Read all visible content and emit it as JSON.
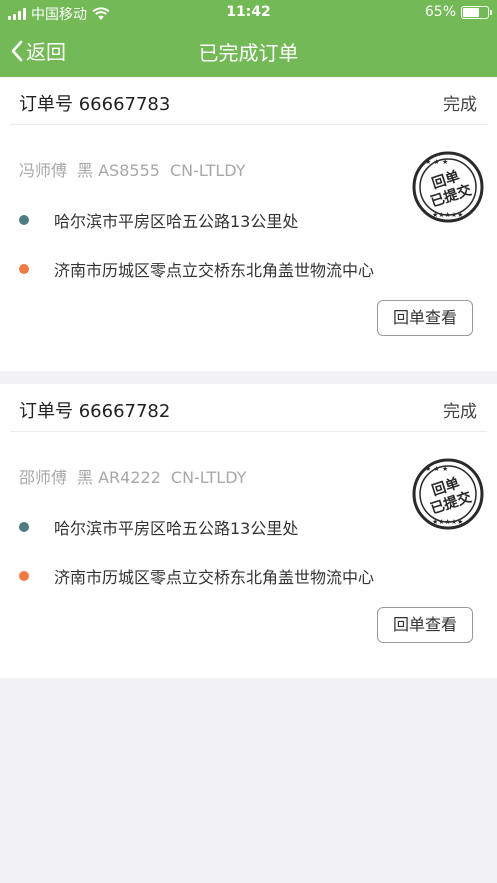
{
  "status_bar": {
    "carrier": "中国移动",
    "time": "11:42",
    "battery": "65%",
    "battery_level": 0.65
  },
  "nav": {
    "back_label": "返回",
    "title": "已完成订单"
  },
  "orders": [
    {
      "order_no": "订单号 66667783",
      "status": "完成",
      "driver": "冯师傅",
      "plate": "黑 AS8555",
      "truck": "CN-LTLDY",
      "from": "哈尔滨市平房区哈五公路13公里处",
      "to": "济南市历城区零点立交桥东北角盖世物流中心",
      "receipt_button": "回单查看",
      "stamp_line1": "回单",
      "stamp_line2": "已提交"
    },
    {
      "order_no": "订单号 66667782",
      "status": "完成",
      "driver": "邵师傅",
      "plate": "黑 AR4222",
      "truck": "CN-LTLDY",
      "from": "哈尔滨市平房区哈五公路13公里处",
      "to": "济南市历城区零点立交桥东北角盖世物流中心",
      "receipt_button": "回单查看",
      "stamp_line1": "回单",
      "stamp_line2": "已提交"
    }
  ],
  "colors": {
    "brand_green": "#73b956",
    "origin_dot": "#4f7b82",
    "destination_dot": "#ef7a45"
  }
}
